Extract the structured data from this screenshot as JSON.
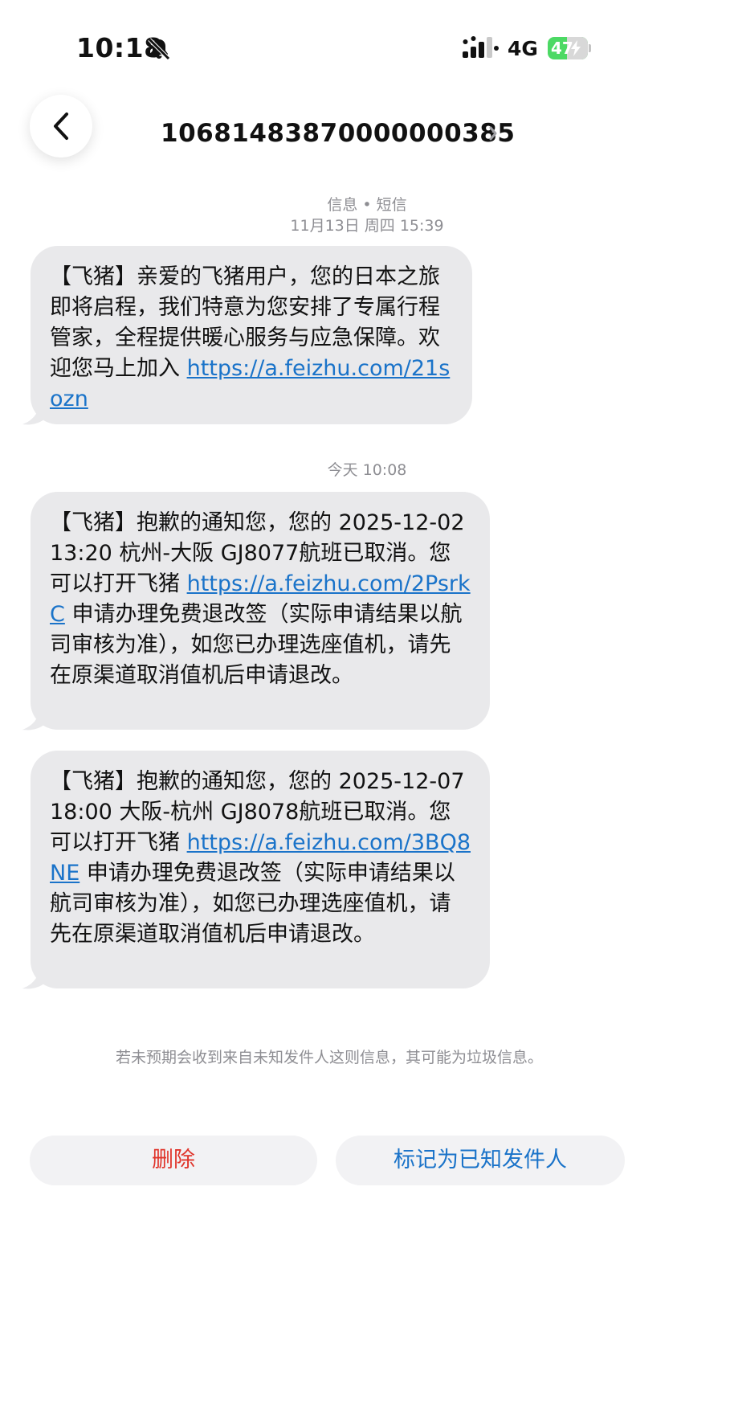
{
  "status_bar": {
    "time": "10:18",
    "silent_icon": "bell-slash-icon",
    "signal_icon": "cellular-signal-icon",
    "network": "4G",
    "battery_level": "47",
    "battery_icon": "battery-charging-icon"
  },
  "header": {
    "back_icon": "chevron-left-icon",
    "sender": "10681483870000000385",
    "chevron_icon": "chevron-right-icon"
  },
  "conversation": {
    "service_label": "信息 • 短信",
    "first_timestamp": "11月13日 周四 15:39",
    "second_timestamp": "今天 10:08",
    "messages": [
      {
        "text": "【飞猪】亲爱的飞猪用户，您的日本之旅即将启程，我们特意为您安排了专属行程管家，全程提供暖心服务与应急保障。欢迎您马上加入",
        "link": "https://a.feizhu.com/21sozn",
        "suffix": ""
      },
      {
        "text": "【飞猪】抱歉的通知您，您的 2025-12-02 13:20 杭州-大阪 GJ8077航班已取消。您可以打开飞猪",
        "link": "https://a.feizhu.com/2PsrkC",
        "suffix": "申请办理免费退改签（实际申请结果以航司审核为准），如您已办理选座值机，请先在原渠道取消值机后申请退改。"
      },
      {
        "text": "【飞猪】抱歉的通知您，您的 2025-12-07 18:00 大阪-杭州 GJ8078航班已取消。您可以打开飞猪",
        "link": "https://a.feizhu.com/3BQ8NE",
        "suffix": "申请办理免费退改签（实际申请结果以航司审核为准），如您已办理选座值机，请先在原渠道取消值机后申请退改。"
      }
    ]
  },
  "footer": {
    "spam_notice": "若未预期会收到来自未知发件人这则信息，其可能为垃圾信息。",
    "delete_label": "删除",
    "mark_known_label": "标记为已知发件人"
  },
  "colors": {
    "bubble": "#e9e9eb",
    "link": "#1a73c9",
    "delete": "#e0352b",
    "battery": "#4cd964"
  }
}
